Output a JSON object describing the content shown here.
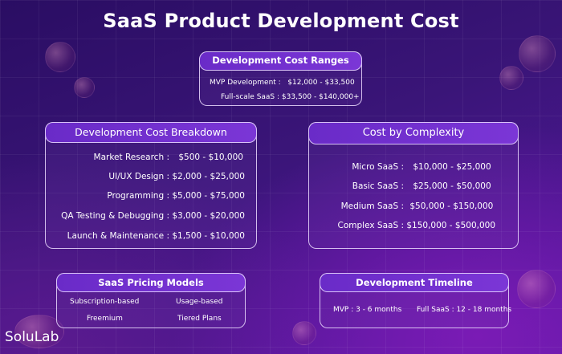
{
  "title": "SaaS Product Development Cost",
  "ranges": {
    "heading": "Development Cost Ranges",
    "rows": [
      {
        "label": "MVP Development :",
        "value": "$12,000 - $33,500"
      },
      {
        "label": "Full-scale SaaS :",
        "value": "$33,500 - $140,000+"
      }
    ]
  },
  "breakdown": {
    "heading": "Development Cost Breakdown",
    "rows": [
      {
        "label": "Market Research :",
        "value": "$500 - $10,000"
      },
      {
        "label": "UI/UX Design :",
        "value": "$2,000 - $25,000"
      },
      {
        "label": "Programming :",
        "value": "$5,000 - $75,000"
      },
      {
        "label": "QA Testing & Debugging :",
        "value": "$3,000 - $20,000"
      },
      {
        "label": "Launch & Maintenance :",
        "value": "$1,500 - $10,000"
      }
    ]
  },
  "complexity": {
    "heading": "Cost by Complexity",
    "rows": [
      {
        "label": "Micro SaaS :",
        "value": "$10,000 - $25,000"
      },
      {
        "label": "Basic SaaS :",
        "value": "$25,000 - $50,000"
      },
      {
        "label": "Medium SaaS :",
        "value": "$50,000 - $150,000"
      },
      {
        "label": "Complex SaaS :",
        "value": "$150,000 - $500,000"
      }
    ]
  },
  "pricing": {
    "heading": "SaaS Pricing Models",
    "items": [
      "Subscription-based",
      "Usage-based",
      "Freemium",
      "Tiered Plans"
    ]
  },
  "timeline": {
    "heading": "Development Timeline",
    "items": [
      "MVP : 3 - 6 months",
      "Full SaaS : 12 - 18 months"
    ]
  },
  "brand": "SoluLab"
}
